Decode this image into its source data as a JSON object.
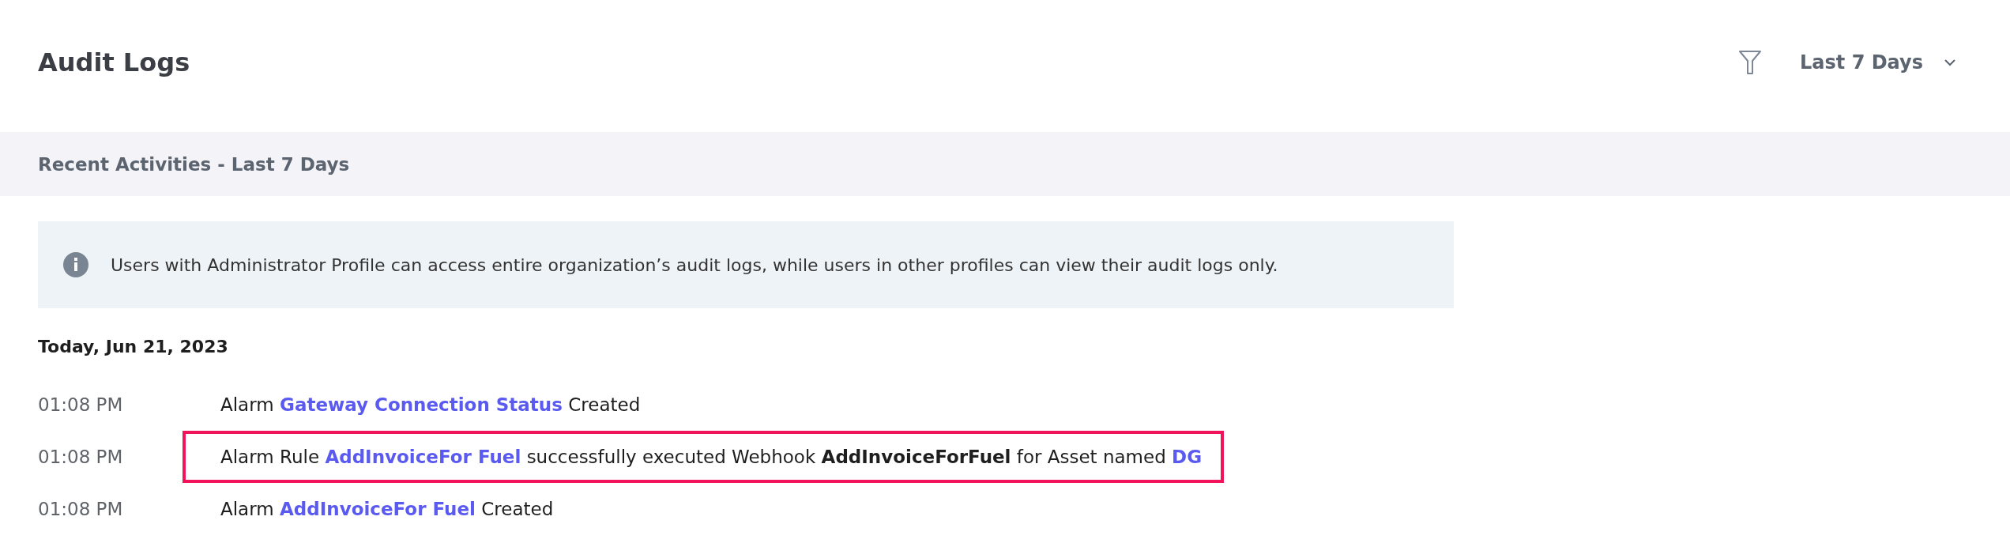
{
  "header": {
    "title": "Audit Logs",
    "range_dropdown": "Last 7 Days"
  },
  "section_bar": {
    "title": "Recent Activities - Last 7 Days"
  },
  "info": {
    "text": "Users with Administrator Profile can access entire organization’s audit logs, while users in other profiles can view their audit logs only."
  },
  "day_heading": "Today, Jun 21, 2023",
  "entries": [
    {
      "time": "01:08 PM",
      "highlighted": false,
      "parts": [
        {
          "kind": "text",
          "text": "Alarm"
        },
        {
          "kind": "link",
          "text": "Gateway Connection Status"
        },
        {
          "kind": "text",
          "text": "Created"
        }
      ]
    },
    {
      "time": "01:08 PM",
      "highlighted": true,
      "parts": [
        {
          "kind": "text",
          "text": "Alarm Rule"
        },
        {
          "kind": "link",
          "text": "AddInvoiceFor Fuel"
        },
        {
          "kind": "text",
          "text": "successfully executed Webhook **AddInvoiceForFuel** for Asset named"
        },
        {
          "kind": "link",
          "text": "DG"
        }
      ]
    },
    {
      "time": "01:08 PM",
      "highlighted": false,
      "parts": [
        {
          "kind": "text",
          "text": "Alarm"
        },
        {
          "kind": "link",
          "text": "AddInvoiceFor Fuel"
        },
        {
          "kind": "text",
          "text": "Created"
        }
      ]
    }
  ]
}
